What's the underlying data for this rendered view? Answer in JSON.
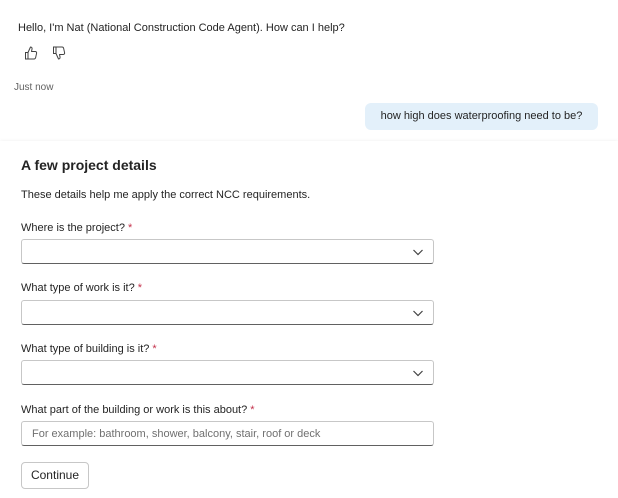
{
  "chat": {
    "bot_message": "Hello, I'm Nat (National Construction Code Agent). How can I help?",
    "timestamp": "Just now",
    "user_message": "how high does waterproofing need to be?",
    "feedback_icons": [
      "thumbs-up-icon",
      "thumbs-down-icon"
    ]
  },
  "form": {
    "title": "A few project details",
    "description": "These details help me apply the correct NCC requirements.",
    "required_marker": "*",
    "fields": [
      {
        "label": "Where is the project?",
        "type": "select",
        "value": ""
      },
      {
        "label": "What type of work is it?",
        "type": "select",
        "value": ""
      },
      {
        "label": "What type of building is it?",
        "type": "select",
        "value": ""
      },
      {
        "label": "What part of the building or work is this about?",
        "type": "text",
        "value": "",
        "placeholder": "For example: bathroom, shower, balcony, stair, roof or deck"
      }
    ],
    "continue_label": "Continue"
  },
  "colors": {
    "user_bubble": "#e3f0fa",
    "required": "#c4314b",
    "text": "#242424"
  }
}
